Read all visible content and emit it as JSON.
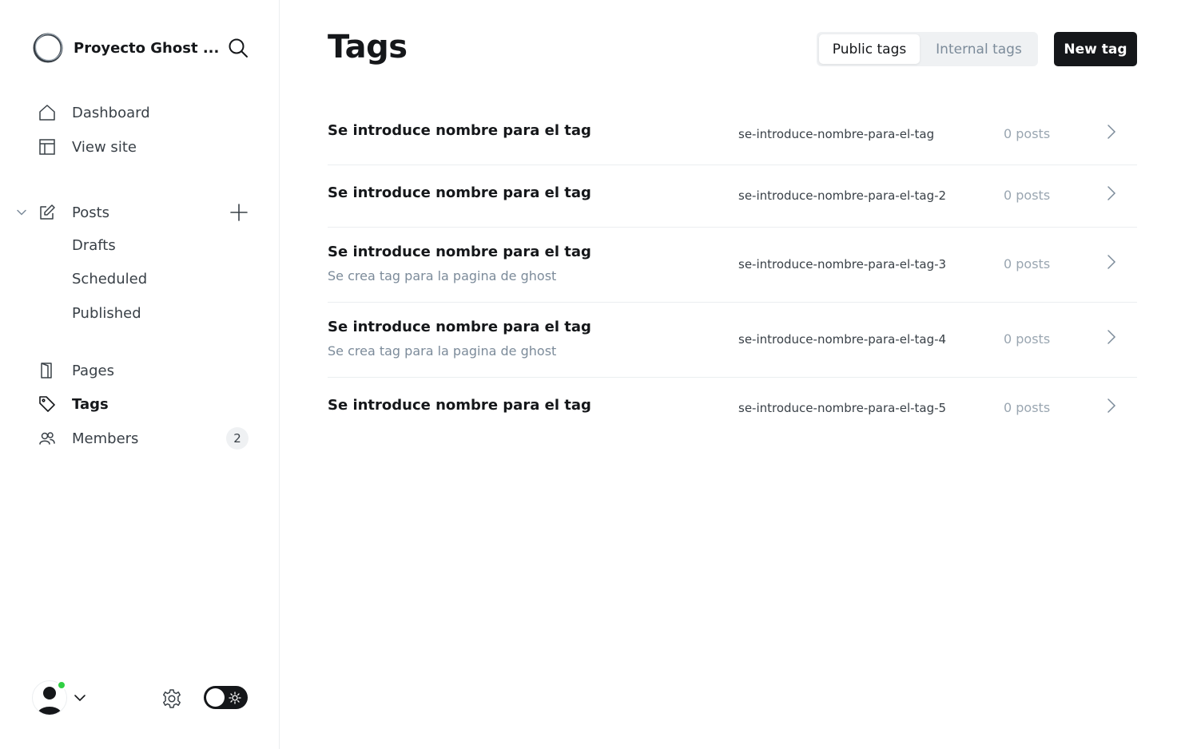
{
  "site": {
    "title": "Proyecto Ghost ..."
  },
  "nav": {
    "dashboard": "Dashboard",
    "view_site": "View site",
    "posts": "Posts",
    "drafts": "Drafts",
    "scheduled": "Scheduled",
    "published": "Published",
    "pages": "Pages",
    "tags": "Tags",
    "members": "Members",
    "members_count": "2"
  },
  "header": {
    "title": "Tags",
    "tabs": [
      "Public tags",
      "Internal tags"
    ],
    "active_tab": "Public tags",
    "new_button": "New tag"
  },
  "tags": [
    {
      "name": "Se introduce nombre para el tag",
      "description": "",
      "slug": "se-introduce-nombre-para-el-tag",
      "count": "0 posts"
    },
    {
      "name": "Se introduce nombre para el tag",
      "description": "",
      "slug": "se-introduce-nombre-para-el-tag-2",
      "count": "0 posts"
    },
    {
      "name": "Se introduce nombre para el tag",
      "description": "Se crea tag para la pagina de ghost",
      "slug": "se-introduce-nombre-para-el-tag-3",
      "count": "0 posts"
    },
    {
      "name": "Se introduce nombre para el tag",
      "description": "Se crea tag para la pagina de ghost",
      "slug": "se-introduce-nombre-para-el-tag-4",
      "count": "0 posts"
    },
    {
      "name": "Se introduce nombre para el tag",
      "description": "",
      "slug": "se-introduce-nombre-para-el-tag-5",
      "count": "0 posts"
    }
  ],
  "colors": {
    "primary_dark": "#15171a",
    "muted_text": "#7c8b9a",
    "online_status": "#30cf43",
    "divider": "#ebeef0"
  },
  "icons": {
    "search": "search-icon",
    "dashboard": "home-icon",
    "view_site": "layout-icon",
    "posts": "edit-icon",
    "pages": "page-icon",
    "tags": "tag-icon",
    "members": "users-icon",
    "settings": "gear-icon",
    "theme": "sun-icon",
    "row": "chevron-right-icon"
  }
}
